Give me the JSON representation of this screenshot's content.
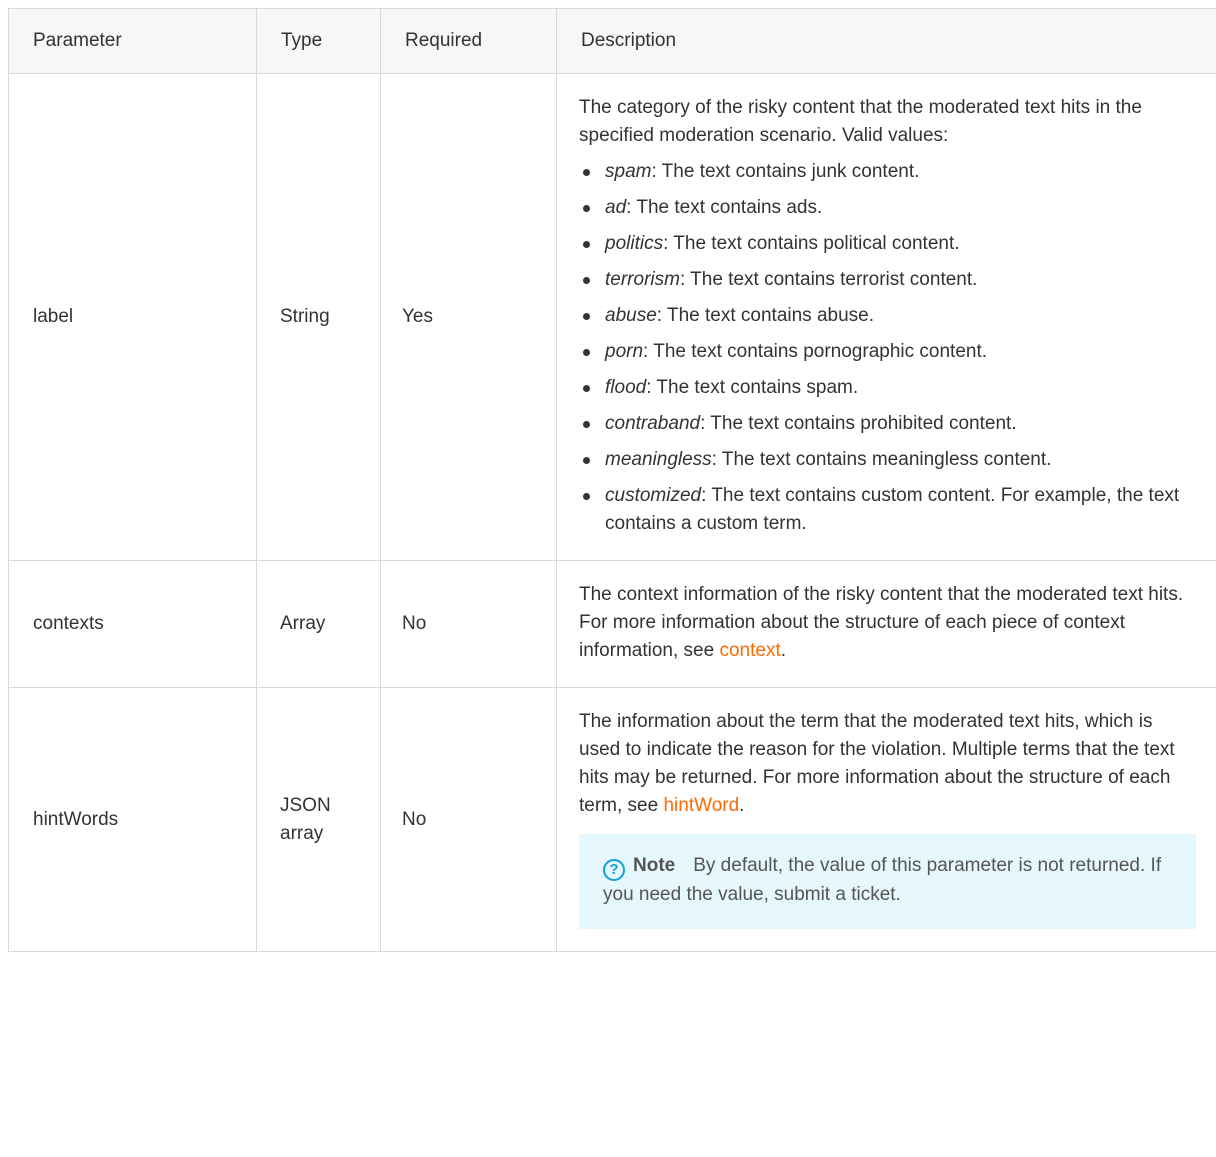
{
  "table": {
    "headers": [
      "Parameter",
      "Type",
      "Required",
      "Description"
    ],
    "rows": [
      {
        "parameter": "label",
        "type": "String",
        "required": "Yes",
        "description_intro": "The category of the risky content that the moderated text hits in the specified moderation scenario. Valid values:",
        "values": [
          {
            "name": "spam",
            "text": ": The text contains junk content."
          },
          {
            "name": "ad",
            "text": ": The text contains ads."
          },
          {
            "name": "politics",
            "text": ": The text contains political content."
          },
          {
            "name": "terrorism",
            "text": ": The text contains terrorist content."
          },
          {
            "name": "abuse",
            "text": ": The text contains abuse."
          },
          {
            "name": "porn",
            "text": ": The text contains pornographic content."
          },
          {
            "name": "flood",
            "text": ": The text contains spam."
          },
          {
            "name": "contraband",
            "text": ": The text contains prohibited content."
          },
          {
            "name": "meaningless",
            "text": ": The text contains meaningless content."
          },
          {
            "name": "customized",
            "text": ": The text contains custom content. For example, the text contains a custom term."
          }
        ]
      },
      {
        "parameter": "contexts",
        "type": "Array",
        "required": "No",
        "description_text": "The context information of the risky content that the moderated text hits. For more information about the structure of each piece of context information, see ",
        "description_link": "context",
        "description_end": "."
      },
      {
        "parameter": "hintWords",
        "type": "JSON array",
        "required": "No",
        "description_text": "The information about the term that the moderated text hits, which is used to indicate the reason for the violation. Multiple terms that the text hits may be returned. For more information about the structure of each term, see ",
        "description_link": "hintWord",
        "description_end": ".",
        "note": {
          "icon": "question-circle-icon",
          "title": "Note",
          "text": "By default, the value of this parameter is not returned. If you need the value, submit a ticket."
        }
      }
    ]
  },
  "colors": {
    "link": "#ff6a00",
    "note_background": "#e6f7fd",
    "note_icon": "#0fa0d8",
    "header_background": "#f7f7f7",
    "border": "#d9d9d9"
  }
}
